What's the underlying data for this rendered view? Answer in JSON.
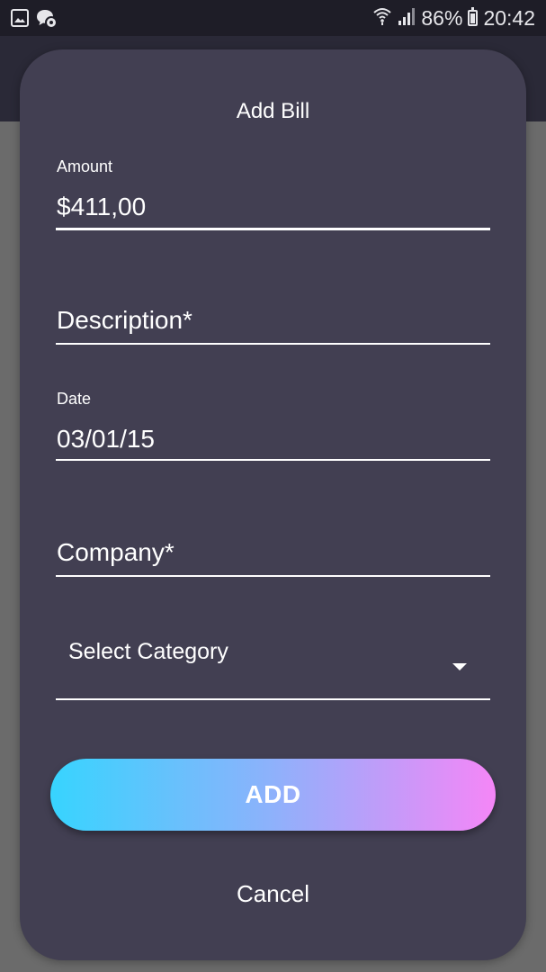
{
  "status_bar": {
    "battery_percent": "86%",
    "time": "20:42",
    "icons": [
      "image-icon",
      "chat-settings-icon",
      "wifi-icon",
      "signal-icon",
      "battery-icon"
    ]
  },
  "dialog": {
    "title": "Add Bill",
    "amount": {
      "label": "Amount",
      "value": "$411,00"
    },
    "description": {
      "placeholder": "Description*"
    },
    "date": {
      "label": "Date",
      "value": "03/01/15"
    },
    "company": {
      "placeholder": "Company*"
    },
    "category": {
      "selected": "Select Category"
    },
    "add_label": "ADD",
    "cancel_label": "Cancel"
  },
  "colors": {
    "dialog_bg": "#423f52",
    "status_bar_bg": "#1e1d27",
    "scrim": "#6b6b6b",
    "button_gradient_start": "#37d4fe",
    "button_gradient_end": "#f586f7"
  }
}
